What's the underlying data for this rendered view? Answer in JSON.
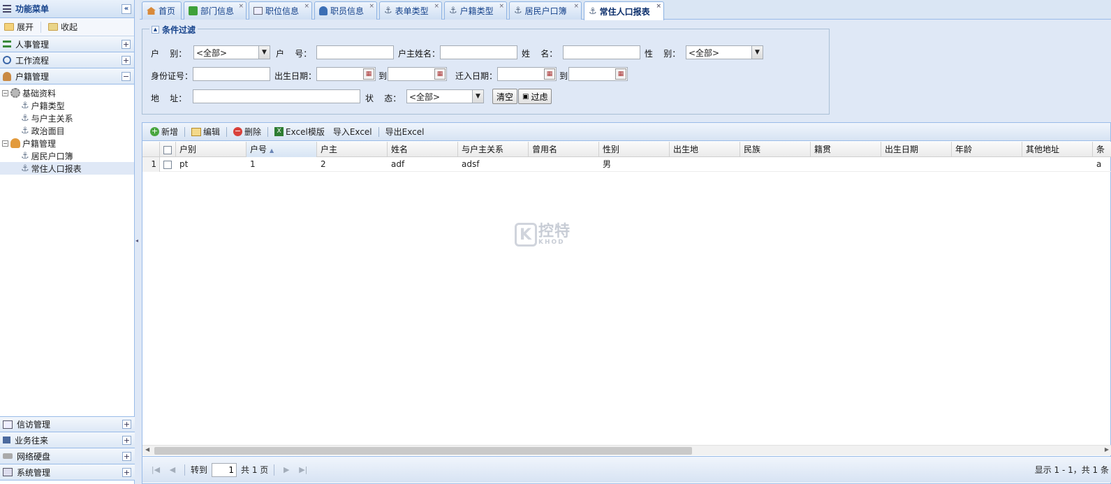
{
  "sidebar": {
    "title": "功能菜单",
    "collapse_icon": "«",
    "expand_label": "展开",
    "collapse_label": "收起",
    "sections": [
      {
        "label": "人事管理",
        "toggle": "+"
      },
      {
        "label": "工作流程",
        "toggle": "+"
      },
      {
        "label": "户籍管理",
        "toggle": "−"
      }
    ],
    "tree": [
      {
        "label": "基础资料",
        "box": "−"
      },
      {
        "label": "户籍类型"
      },
      {
        "label": "与户主关系"
      },
      {
        "label": "政治面目"
      },
      {
        "label": "户籍管理",
        "box": "−"
      },
      {
        "label": "居民户口簿"
      },
      {
        "label": "常住人口报表"
      }
    ],
    "bottom_sections": [
      {
        "label": "信访管理",
        "toggle": "+"
      },
      {
        "label": "业务往来",
        "toggle": "+"
      },
      {
        "label": "网络硬盘",
        "toggle": "+"
      },
      {
        "label": "系统管理",
        "toggle": "+"
      }
    ]
  },
  "tabs": [
    {
      "label": "首页",
      "icon": "home-icon"
    },
    {
      "label": "部门信息",
      "icon": "puzzle-icon",
      "close": "×"
    },
    {
      "label": "职位信息",
      "icon": "card-icon",
      "close": "×"
    },
    {
      "label": "职员信息",
      "icon": "person-icon",
      "close": "×"
    },
    {
      "label": "表单类型",
      "icon": "anchor-icon",
      "close": "×"
    },
    {
      "label": "户籍类型",
      "icon": "anchor-icon",
      "close": "×"
    },
    {
      "label": "居民户口簿",
      "icon": "anchor-icon",
      "close": "×"
    },
    {
      "label": "常住人口报表",
      "icon": "anchor-icon",
      "close": "×"
    }
  ],
  "filter": {
    "legend": "条件过滤",
    "labels": {
      "hubie": "户    别：",
      "huhao": "户    号：",
      "huzhu": "户主姓名：",
      "xingming": "姓    名：",
      "xingbie": "性    别：",
      "sfz": "身份证号：",
      "birth": "出生日期：",
      "to1": "到",
      "movein": "迁入日期：",
      "to2": "到",
      "addr": "地    址：",
      "status": "状    态："
    },
    "hubie_value": "<全部>",
    "xingbie_value": "<全部>",
    "status_value": "<全部>",
    "clear_button": "清空",
    "filter_button": "过虑"
  },
  "toolbar": {
    "add": "新增",
    "edit": "编辑",
    "delete": "删除",
    "excel_template": "Excel模版",
    "import": "导入Excel",
    "export": "导出Excel"
  },
  "grid": {
    "columns": [
      "户别",
      "户号",
      "户主",
      "姓名",
      "与户主关系",
      "曾用名",
      "性别",
      "出生地",
      "民族",
      "籍贯",
      "出生日期",
      "年龄",
      "其他地址",
      "条"
    ],
    "rows": [
      {
        "num": "1",
        "cells": [
          "pt",
          "1",
          "2",
          "adf",
          "adsf",
          "",
          "男",
          "",
          "",
          "",
          "",
          "",
          "",
          "a"
        ]
      }
    ]
  },
  "watermark": {
    "k": "K",
    "text": "控特",
    "sub": "KHOD"
  },
  "pager": {
    "goto": "转到",
    "page": "1",
    "total": "共 1 页",
    "info": "显示 1 - 1，共 1 条"
  }
}
